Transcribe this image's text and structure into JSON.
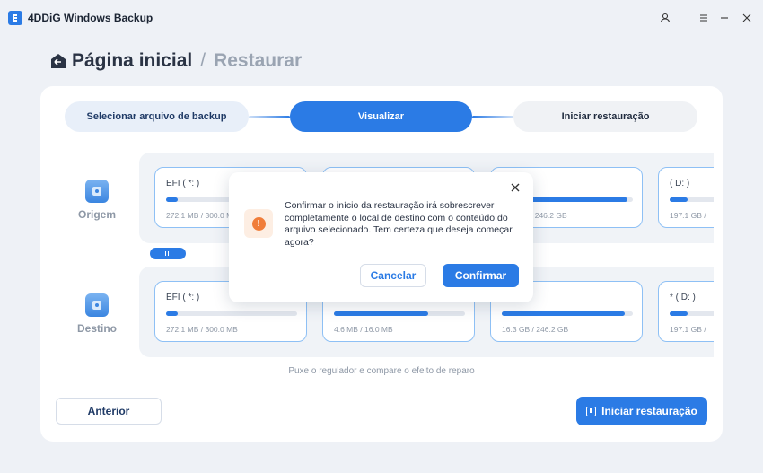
{
  "app": {
    "title": "4DDiG Windows Backup"
  },
  "heading": {
    "home": "Página inicial",
    "separator": "/",
    "current": "Restaurar"
  },
  "steps": [
    {
      "label": "Selecionar arquivo de backup"
    },
    {
      "label": "Visualizar"
    },
    {
      "label": "Iniciar restauração"
    }
  ],
  "origin": {
    "label": "Origem",
    "partitions": [
      {
        "name": "EFI ( *: )",
        "size": "272.1 MB / 300.0 MB",
        "fill": 0.09
      },
      {
        "name": "",
        "size": "",
        "fill": 0.73
      },
      {
        "name": ")",
        "size": "/ 246.2 GB",
        "fill": 0.96
      },
      {
        "name": "( D: )",
        "size": "197.1 GB /",
        "fill": 0.4
      }
    ]
  },
  "destination": {
    "label": "Destino",
    "partitions": [
      {
        "name": "EFI ( *: )",
        "size": "272.1 MB / 300.0 MB",
        "fill": 0.09
      },
      {
        "name": "",
        "size": "4.6 MB / 16.0 MB",
        "fill": 0.72
      },
      {
        "name": "",
        "size": "16.3 GB / 246.2 GB",
        "fill": 0.94
      },
      {
        "name": "* ( D: )",
        "size": "197.1 GB /",
        "fill": 0.4
      }
    ]
  },
  "hint": "Puxe o regulador e compare o efeito de reparo",
  "buttons": {
    "previous": "Anterior",
    "start": "Iniciar restauração"
  },
  "dialog": {
    "message": "Confirmar o início da restauração irá sobrescrever completamente o local de destino com o conteúdo do arquivo selecionado. Tem certeza que deseja começar agora?",
    "cancel": "Cancelar",
    "confirm": "Confirmar",
    "warning_icon": "!"
  },
  "colors": {
    "accent": "#2b7be5",
    "warning": "#f07d3a"
  }
}
